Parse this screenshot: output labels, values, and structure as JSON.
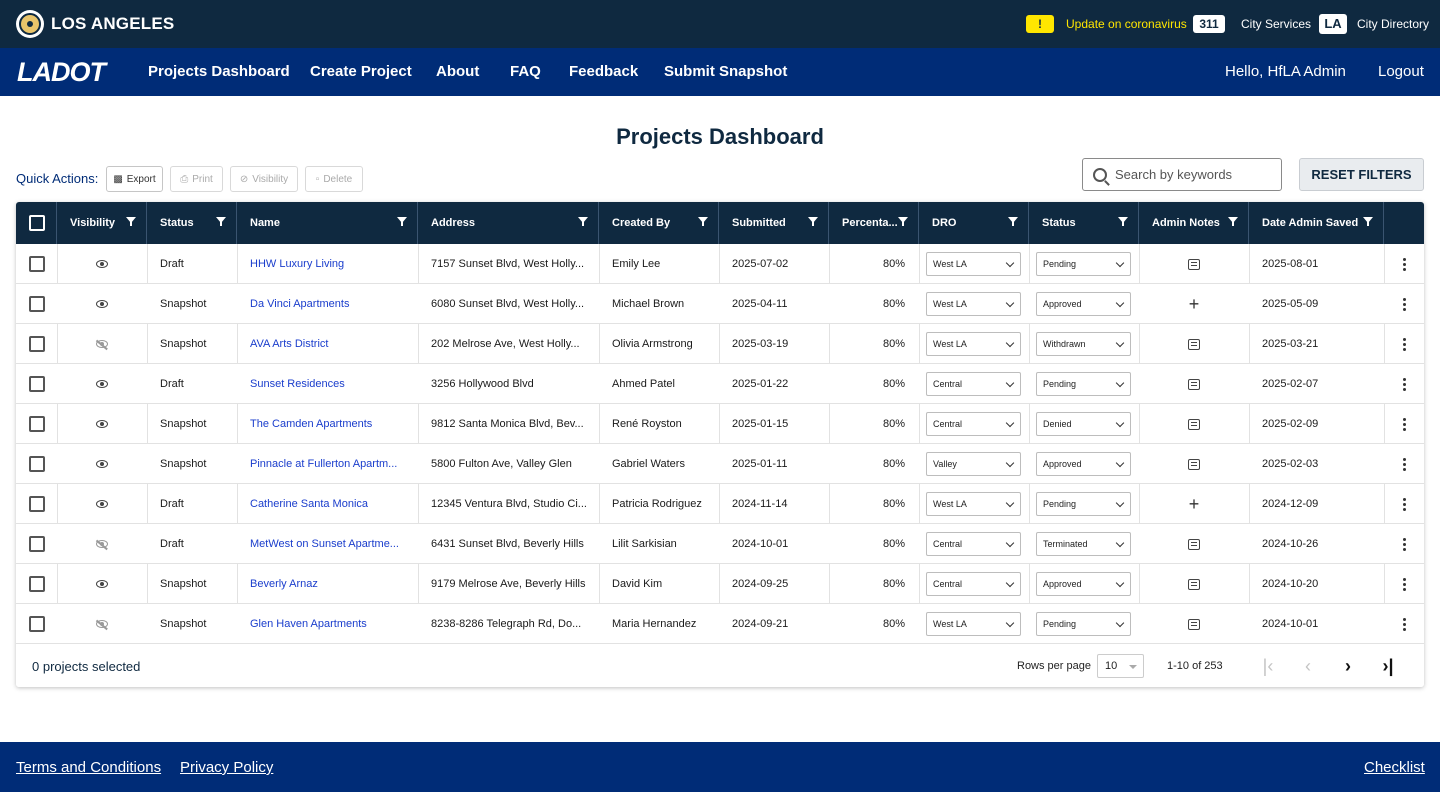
{
  "city_bar": {
    "name": "LOS ANGELES",
    "alert_symbol": "!",
    "alert_text": "Update on coronavirus",
    "badge_311": "311",
    "city_services": "City Services",
    "badge_la": "LA",
    "city_directory": "City Directory"
  },
  "nav": {
    "logo": "LADOT",
    "items": [
      "Projects Dashboard",
      "Create Project",
      "About",
      "FAQ",
      "Feedback",
      "Submit Snapshot"
    ],
    "greeting": "Hello, HfLA Admin",
    "logout": "Logout"
  },
  "page_title": "Projects Dashboard",
  "quick_actions": {
    "label": "Quick Actions:",
    "export": "Export",
    "print": "Print",
    "visibility": "Visibility",
    "delete": "Delete"
  },
  "search": {
    "placeholder": "Search by keywords"
  },
  "reset_filters": "RESET FILTERS",
  "table": {
    "columns": [
      "Visibility",
      "Status",
      "Name",
      "Address",
      "Created By",
      "Submitted",
      "Percenta...",
      "DRO",
      "Status",
      "Admin Notes",
      "Date Admin Saved"
    ],
    "rows": [
      {
        "visible": true,
        "status": "Draft",
        "name": "HHW Luxury Living",
        "address": "7157 Sunset Blvd, West Holly...",
        "created_by": "Emily Lee",
        "submitted": "2025-07-02",
        "percent": "80%",
        "dro": "West LA",
        "approval": "Pending",
        "note": "note",
        "saved": "2025-08-01"
      },
      {
        "visible": true,
        "status": "Snapshot",
        "name": "Da Vinci Apartments",
        "address": "6080 Sunset Blvd, West Holly...",
        "created_by": "Michael Brown",
        "submitted": "2025-04-11",
        "percent": "80%",
        "dro": "West LA",
        "approval": "Approved",
        "note": "add",
        "saved": "2025-05-09"
      },
      {
        "visible": false,
        "status": "Snapshot",
        "name": "AVA Arts District",
        "address": "202 Melrose Ave, West Holly...",
        "created_by": "Olivia Armstrong",
        "submitted": "2025-03-19",
        "percent": "80%",
        "dro": "West LA",
        "approval": "Withdrawn",
        "note": "note",
        "saved": "2025-03-21"
      },
      {
        "visible": true,
        "status": "Draft",
        "name": "Sunset Residences",
        "address": "3256 Hollywood Blvd",
        "created_by": "Ahmed Patel",
        "submitted": "2025-01-22",
        "percent": "80%",
        "dro": "Central",
        "approval": "Pending",
        "note": "note",
        "saved": "2025-02-07"
      },
      {
        "visible": true,
        "status": "Snapshot",
        "name": "The Camden Apartments",
        "address": "9812 Santa Monica Blvd, Bev...",
        "created_by": "René Royston",
        "submitted": "2025-01-15",
        "percent": "80%",
        "dro": "Central",
        "approval": "Denied",
        "note": "note",
        "saved": "2025-02-09"
      },
      {
        "visible": true,
        "status": "Snapshot",
        "name": "Pinnacle at Fullerton Apartm...",
        "address": "5800 Fulton Ave, Valley Glen",
        "created_by": "Gabriel Waters",
        "submitted": "2025-01-11",
        "percent": "80%",
        "dro": "Valley",
        "approval": "Approved",
        "note": "note",
        "saved": "2025-02-03"
      },
      {
        "visible": true,
        "status": "Draft",
        "name": "Catherine Santa Monica",
        "address": "12345 Ventura Blvd, Studio Ci...",
        "created_by": "Patricia Rodriguez",
        "submitted": "2024-11-14",
        "percent": "80%",
        "dro": "West LA",
        "approval": "Pending",
        "note": "add",
        "saved": "2024-12-09"
      },
      {
        "visible": false,
        "status": "Draft",
        "name": "MetWest on Sunset Apartme...",
        "address": "6431 Sunset Blvd, Beverly Hills",
        "created_by": "Lilit Sarkisian",
        "submitted": "2024-10-01",
        "percent": "80%",
        "dro": "Central",
        "approval": "Terminated",
        "note": "note",
        "saved": "2024-10-26"
      },
      {
        "visible": true,
        "status": "Snapshot",
        "name": "Beverly Arnaz",
        "address": "9179 Melrose Ave, Beverly Hills",
        "created_by": "David Kim",
        "submitted": "2024-09-25",
        "percent": "80%",
        "dro": "Central",
        "approval": "Approved",
        "note": "note",
        "saved": "2024-10-20"
      },
      {
        "visible": false,
        "status": "Snapshot",
        "name": "Glen Haven Apartments",
        "address": "8238-8286 Telegraph Rd, Do...",
        "created_by": "Maria Hernandez",
        "submitted": "2024-09-21",
        "percent": "80%",
        "dro": "West LA",
        "approval": "Pending",
        "note": "note",
        "saved": "2024-10-01"
      }
    ]
  },
  "footer_table": {
    "selected": "0 projects selected",
    "rows_per_page_label": "Rows per page",
    "rows_per_page": "10",
    "range": "1-10 of 253"
  },
  "footer": {
    "terms": "Terms and Conditions",
    "privacy": "Privacy Policy",
    "checklist": "Checklist"
  },
  "colors": {
    "top_bar": "#0f2940",
    "nav_bar": "#002c77",
    "alert": "#ffe600",
    "link": "#1a3dcc"
  }
}
